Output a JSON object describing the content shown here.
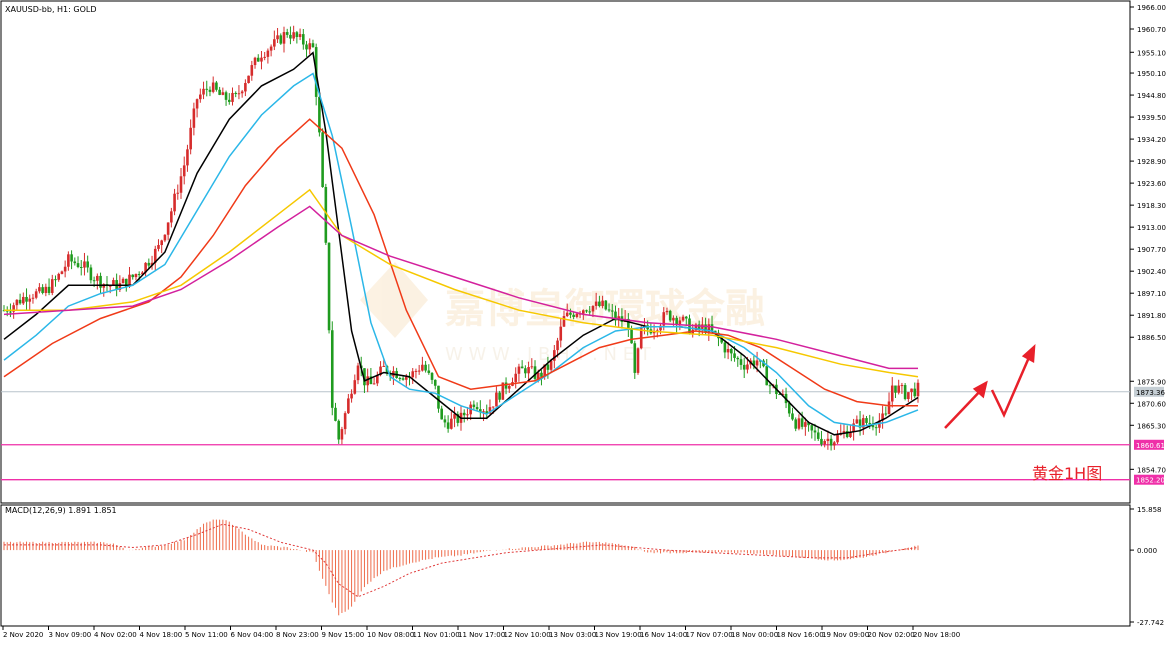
{
  "header": {
    "symbol_info": "XAUUSD-bb, H1:  GOLD"
  },
  "macd": {
    "label": "MACD(12,26,9) 1.891 1.851",
    "ticks": [
      "15.858",
      "0.000",
      "-27.742"
    ]
  },
  "watermark": {
    "line1": "嘉博皇御環球金融",
    "line2": "W W W . J B H Y . N E T"
  },
  "annotation": {
    "text": "黄金1H图"
  },
  "price_tags": {
    "current": "1873.36",
    "support1": "1860.61",
    "support2": "1852.20"
  },
  "colors": {
    "up_candle": "#d62c2c",
    "down_candle": "#1f9b1f",
    "ma_black": "#000000",
    "ma_cyan": "#2bb7e8",
    "ma_red": "#f03a18",
    "ma_yellow": "#f6c800",
    "ma_magenta": "#d3219d",
    "support_line": "#ef2fa8",
    "current_line": "#b8c4cc",
    "annotation": "#e8202a",
    "macd_hist": "#ee6b4a",
    "macd_signal": "#e03a3a"
  },
  "chart_data": {
    "type": "candlestick",
    "symbol": "XAUUSD-bb",
    "timeframe": "H1",
    "ylim": [
      1849,
      1966
    ],
    "y_ticks": [
      "1966.00",
      "1960.70",
      "1955.10",
      "1950.10",
      "1944.80",
      "1939.50",
      "1934.20",
      "1928.90",
      "1923.60",
      "1918.30",
      "1913.00",
      "1907.70",
      "1902.40",
      "1897.10",
      "1891.80",
      "1886.50",
      "1875.90",
      "1870.60",
      "1865.30",
      "1854.70"
    ],
    "x_ticks": [
      "2 Nov 2020",
      "3 Nov 09:00",
      "4 Nov 02:00",
      "4 Nov 18:00",
      "5 Nov 11:00",
      "6 Nov 04:00",
      "8 Nov 23:00",
      "9 Nov 15:00",
      "10 Nov 08:00",
      "11 Nov 01:00",
      "11 Nov 17:00",
      "12 Nov 10:00",
      "13 Nov 03:00",
      "13 Nov 19:00",
      "16 Nov 14:00",
      "17 Nov 07:00",
      "18 Nov 00:00",
      "18 Nov 16:00",
      "19 Nov 09:00",
      "20 Nov 02:00",
      "20 Nov 18:00"
    ],
    "price_path": [
      [
        0,
        1893
      ],
      [
        4,
        1895
      ],
      [
        8,
        1897
      ],
      [
        12,
        1897
      ],
      [
        16,
        1900
      ],
      [
        20,
        1905
      ],
      [
        24,
        1904
      ],
      [
        28,
        1901
      ],
      [
        32,
        1899
      ],
      [
        36,
        1899
      ],
      [
        40,
        1901
      ],
      [
        44,
        1904
      ],
      [
        48,
        1908
      ],
      [
        52,
        1917
      ],
      [
        56,
        1928
      ],
      [
        60,
        1944
      ],
      [
        64,
        1947
      ],
      [
        68,
        1944
      ],
      [
        72,
        1944
      ],
      [
        76,
        1950
      ],
      [
        80,
        1955
      ],
      [
        84,
        1957
      ],
      [
        88,
        1960
      ],
      [
        92,
        1958
      ],
      [
        96,
        1956
      ],
      [
        98,
        1935
      ],
      [
        100,
        1908
      ],
      [
        102,
        1870
      ],
      [
        104,
        1862
      ],
      [
        106,
        1868
      ],
      [
        110,
        1881
      ],
      [
        112,
        1876
      ],
      [
        114,
        1875
      ],
      [
        118,
        1879
      ],
      [
        122,
        1878
      ],
      [
        126,
        1877
      ],
      [
        130,
        1880
      ],
      [
        134,
        1874
      ],
      [
        136,
        1866
      ],
      [
        138,
        1866
      ],
      [
        142,
        1867
      ],
      [
        146,
        1871
      ],
      [
        150,
        1869
      ],
      [
        154,
        1873
      ],
      [
        158,
        1877
      ],
      [
        162,
        1879
      ],
      [
        166,
        1877
      ],
      [
        170,
        1880
      ],
      [
        174,
        1891
      ],
      [
        178,
        1893
      ],
      [
        182,
        1894
      ],
      [
        186,
        1894
      ],
      [
        190,
        1891
      ],
      [
        194,
        1890
      ],
      [
        196,
        1877
      ],
      [
        198,
        1888
      ],
      [
        202,
        1889
      ],
      [
        206,
        1892
      ],
      [
        210,
        1891
      ],
      [
        214,
        1888
      ],
      [
        218,
        1889
      ],
      [
        222,
        1886
      ],
      [
        226,
        1882
      ],
      [
        230,
        1880
      ],
      [
        234,
        1881
      ],
      [
        238,
        1875
      ],
      [
        242,
        1872
      ],
      [
        246,
        1866
      ],
      [
        250,
        1864
      ],
      [
        254,
        1862
      ],
      [
        258,
        1862
      ],
      [
        262,
        1864
      ],
      [
        266,
        1866
      ],
      [
        270,
        1866
      ],
      [
        274,
        1867
      ],
      [
        276,
        1875
      ],
      [
        280,
        1873
      ],
      [
        284,
        1874
      ]
    ],
    "bar_range": [
      0,
      284
    ],
    "moving_averages": [
      {
        "color_key": "ma_black",
        "points": [
          [
            0,
            1886
          ],
          [
            10,
            1892
          ],
          [
            20,
            1899
          ],
          [
            30,
            1899
          ],
          [
            40,
            1899
          ],
          [
            50,
            1907
          ],
          [
            60,
            1926
          ],
          [
            70,
            1939
          ],
          [
            80,
            1947
          ],
          [
            90,
            1951
          ],
          [
            96,
            1955
          ],
          [
            100,
            1936
          ],
          [
            104,
            1912
          ],
          [
            108,
            1888
          ],
          [
            112,
            1876
          ],
          [
            118,
            1878
          ],
          [
            126,
            1877
          ],
          [
            134,
            1872
          ],
          [
            142,
            1867
          ],
          [
            150,
            1867
          ],
          [
            160,
            1874
          ],
          [
            170,
            1881
          ],
          [
            180,
            1887
          ],
          [
            190,
            1891
          ],
          [
            200,
            1889
          ],
          [
            210,
            1889
          ],
          [
            220,
            1888
          ],
          [
            230,
            1882
          ],
          [
            240,
            1874
          ],
          [
            250,
            1866
          ],
          [
            258,
            1863
          ],
          [
            266,
            1864
          ],
          [
            274,
            1867
          ],
          [
            280,
            1870
          ],
          [
            284,
            1872
          ]
        ]
      },
      {
        "color_key": "ma_cyan",
        "points": [
          [
            0,
            1881
          ],
          [
            10,
            1887
          ],
          [
            20,
            1894
          ],
          [
            30,
            1897
          ],
          [
            40,
            1899
          ],
          [
            50,
            1904
          ],
          [
            60,
            1917
          ],
          [
            70,
            1930
          ],
          [
            80,
            1940
          ],
          [
            90,
            1947
          ],
          [
            96,
            1950
          ],
          [
            102,
            1935
          ],
          [
            108,
            1913
          ],
          [
            114,
            1890
          ],
          [
            120,
            1877
          ],
          [
            126,
            1874
          ],
          [
            134,
            1873
          ],
          [
            142,
            1870
          ],
          [
            150,
            1868
          ],
          [
            160,
            1873
          ],
          [
            170,
            1878
          ],
          [
            180,
            1884
          ],
          [
            190,
            1888
          ],
          [
            200,
            1889
          ],
          [
            210,
            1889
          ],
          [
            220,
            1888
          ],
          [
            230,
            1884
          ],
          [
            240,
            1878
          ],
          [
            250,
            1870
          ],
          [
            258,
            1866
          ],
          [
            266,
            1865
          ],
          [
            274,
            1866
          ],
          [
            284,
            1869
          ]
        ]
      },
      {
        "color_key": "ma_red",
        "points": [
          [
            0,
            1877
          ],
          [
            15,
            1885
          ],
          [
            30,
            1891
          ],
          [
            45,
            1895
          ],
          [
            55,
            1901
          ],
          [
            65,
            1911
          ],
          [
            75,
            1923
          ],
          [
            85,
            1932
          ],
          [
            95,
            1939
          ],
          [
            105,
            1932
          ],
          [
            115,
            1916
          ],
          [
            125,
            1893
          ],
          [
            135,
            1877
          ],
          [
            145,
            1874
          ],
          [
            155,
            1875
          ],
          [
            165,
            1876
          ],
          [
            175,
            1880
          ],
          [
            185,
            1884
          ],
          [
            195,
            1886
          ],
          [
            205,
            1887
          ],
          [
            215,
            1888
          ],
          [
            225,
            1887
          ],
          [
            235,
            1884
          ],
          [
            245,
            1879
          ],
          [
            255,
            1874
          ],
          [
            265,
            1871
          ],
          [
            275,
            1870
          ],
          [
            284,
            1870
          ]
        ]
      },
      {
        "color_key": "ma_yellow",
        "points": [
          [
            0,
            1893
          ],
          [
            20,
            1893
          ],
          [
            40,
            1895
          ],
          [
            55,
            1899
          ],
          [
            70,
            1907
          ],
          [
            85,
            1916
          ],
          [
            95,
            1922
          ],
          [
            105,
            1911
          ],
          [
            120,
            1904
          ],
          [
            140,
            1898
          ],
          [
            160,
            1893
          ],
          [
            180,
            1890
          ],
          [
            200,
            1888
          ],
          [
            220,
            1887
          ],
          [
            240,
            1884
          ],
          [
            260,
            1880
          ],
          [
            275,
            1878
          ],
          [
            284,
            1877
          ]
        ]
      },
      {
        "color_key": "ma_magenta",
        "points": [
          [
            0,
            1892
          ],
          [
            20,
            1893
          ],
          [
            40,
            1894
          ],
          [
            55,
            1898
          ],
          [
            70,
            1905
          ],
          [
            85,
            1913
          ],
          [
            95,
            1918
          ],
          [
            105,
            1911
          ],
          [
            120,
            1906
          ],
          [
            140,
            1901
          ],
          [
            160,
            1896
          ],
          [
            180,
            1892
          ],
          [
            200,
            1890
          ],
          [
            220,
            1889
          ],
          [
            240,
            1886
          ],
          [
            260,
            1882
          ],
          [
            275,
            1879
          ],
          [
            284,
            1879
          ]
        ]
      }
    ],
    "support_levels": [
      1860.61,
      1852.2
    ],
    "current_price": 1873.36,
    "macd": {
      "ylim": [
        -27.742,
        15.858
      ],
      "histogram": [
        [
          0,
          3
        ],
        [
          30,
          3
        ],
        [
          34,
          2.5
        ],
        [
          38,
          0
        ],
        [
          44,
          1
        ],
        [
          50,
          2
        ],
        [
          56,
          4
        ],
        [
          62,
          10
        ],
        [
          66,
          12
        ],
        [
          70,
          11
        ],
        [
          74,
          7
        ],
        [
          80,
          2
        ],
        [
          88,
          1
        ],
        [
          96,
          -1
        ],
        [
          98,
          -8
        ],
        [
          102,
          -20
        ],
        [
          104,
          -25
        ],
        [
          108,
          -22
        ],
        [
          112,
          -14
        ],
        [
          118,
          -8
        ],
        [
          126,
          -5
        ],
        [
          134,
          -3
        ],
        [
          142,
          -2
        ],
        [
          152,
          0
        ],
        [
          162,
          1
        ],
        [
          172,
          2
        ],
        [
          180,
          3
        ],
        [
          186,
          3
        ],
        [
          192,
          2
        ],
        [
          196,
          1
        ],
        [
          200,
          -1
        ],
        [
          210,
          -1
        ],
        [
          220,
          -1
        ],
        [
          230,
          -1
        ],
        [
          240,
          -2
        ],
        [
          250,
          -3
        ],
        [
          258,
          -4
        ],
        [
          266,
          -3
        ],
        [
          274,
          -1
        ],
        [
          280,
          1
        ],
        [
          284,
          1.5
        ]
      ],
      "signal": [
        [
          0,
          2
        ],
        [
          30,
          2
        ],
        [
          40,
          1
        ],
        [
          50,
          2
        ],
        [
          60,
          6
        ],
        [
          68,
          10
        ],
        [
          76,
          8
        ],
        [
          86,
          3
        ],
        [
          96,
          0
        ],
        [
          100,
          -5
        ],
        [
          104,
          -13
        ],
        [
          110,
          -18
        ],
        [
          118,
          -14
        ],
        [
          126,
          -9
        ],
        [
          136,
          -5
        ],
        [
          146,
          -3
        ],
        [
          156,
          -1
        ],
        [
          166,
          0
        ],
        [
          176,
          1
        ],
        [
          186,
          2
        ],
        [
          196,
          1
        ],
        [
          206,
          0
        ],
        [
          220,
          -1
        ],
        [
          236,
          -2
        ],
        [
          252,
          -3
        ],
        [
          262,
          -3
        ],
        [
          272,
          -1
        ],
        [
          284,
          1
        ]
      ]
    }
  }
}
